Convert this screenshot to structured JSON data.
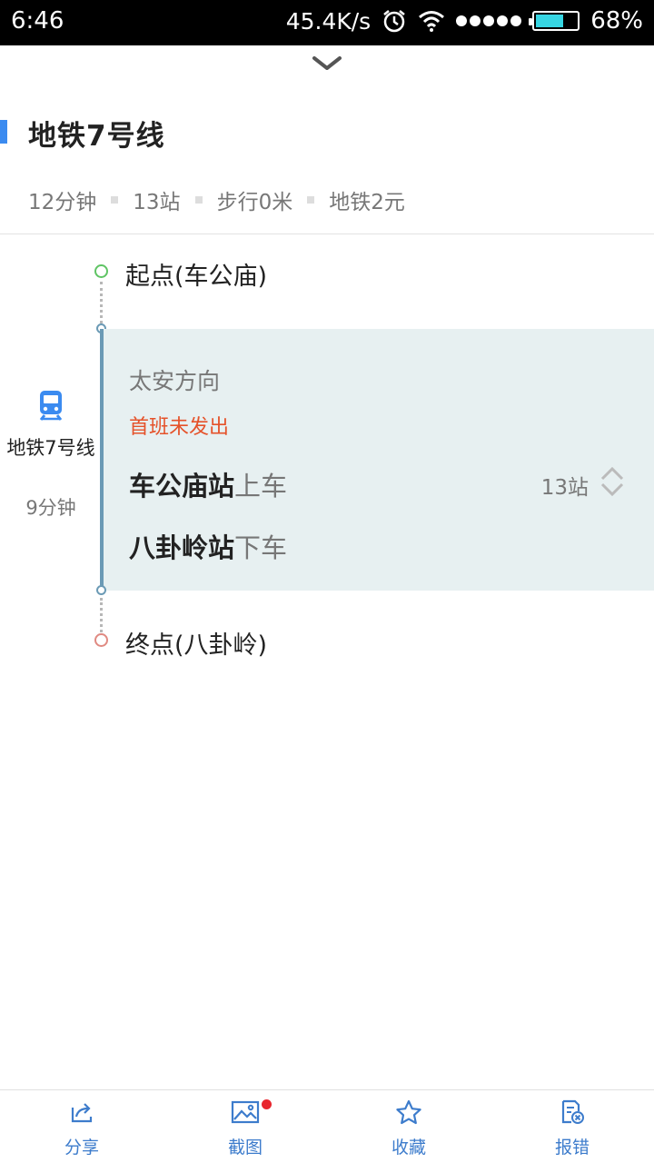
{
  "status_bar": {
    "time": "6:46",
    "net_speed": "45.4K/s",
    "battery": "68%",
    "battery_level": 0.68,
    "icons": [
      "alarm-icon",
      "wifi-icon",
      "signal-icon",
      "battery-icon"
    ]
  },
  "route": {
    "title": "地铁7号线",
    "accent_color": "#3b8bf0",
    "summary": {
      "time": "12分钟",
      "stops": "13站",
      "walk": "步行0米",
      "fare": "地铁2元"
    }
  },
  "timeline": {
    "start_label": "起点(车公庙)",
    "end_label": "终点(八卦岭)",
    "line_name": "地铁7号线",
    "line_duration": "9分钟",
    "segment": {
      "direction": "太安方向",
      "first_train": "首班未发出",
      "board_station": "车公庙站",
      "board_action": "上车",
      "alight_station": "八卦岭站",
      "alight_action": "下车",
      "stops_count": "13站"
    }
  },
  "toolbar": {
    "share": "分享",
    "screenshot": "截图",
    "favorite": "收藏",
    "report": "报错"
  },
  "colors": {
    "line": "#6b9ab5",
    "highlight_bg": "#e7f0f1",
    "warning": "#e5522a",
    "toolbar_text": "#3d7ccc"
  }
}
